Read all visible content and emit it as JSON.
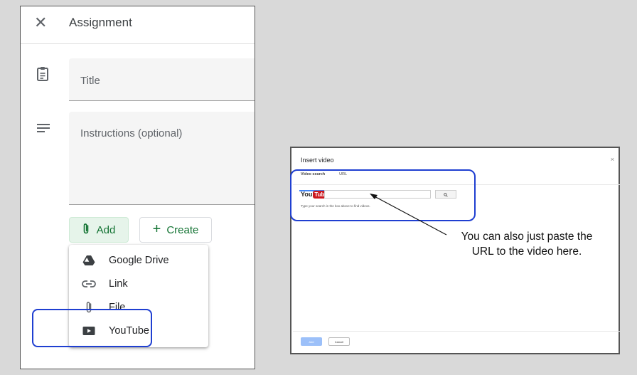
{
  "assignment": {
    "title": "Assignment",
    "title_placeholder": "Title",
    "instructions_placeholder": "Instructions (optional)",
    "add_label": "Add",
    "create_label": "Create",
    "menu": [
      {
        "label": "Google Drive",
        "icon": "google-drive-icon"
      },
      {
        "label": "Link",
        "icon": "link-icon"
      },
      {
        "label": "File",
        "icon": "paperclip-icon"
      },
      {
        "label": "YouTube",
        "icon": "youtube-icon"
      }
    ],
    "accent_color": "#137333",
    "highlight_color": "#1f3fd1"
  },
  "insert_video": {
    "title": "Insert video",
    "close": "×",
    "tabs": [
      "Video search",
      "URL"
    ],
    "logo_you": "You",
    "logo_tube": "Tube",
    "hint": "Type your search in the box above to find videos.",
    "add_label": "Add",
    "cancel_label": "Cancel"
  },
  "annotation": {
    "line1": "You can also just paste the",
    "line2": "URL to the video here."
  }
}
